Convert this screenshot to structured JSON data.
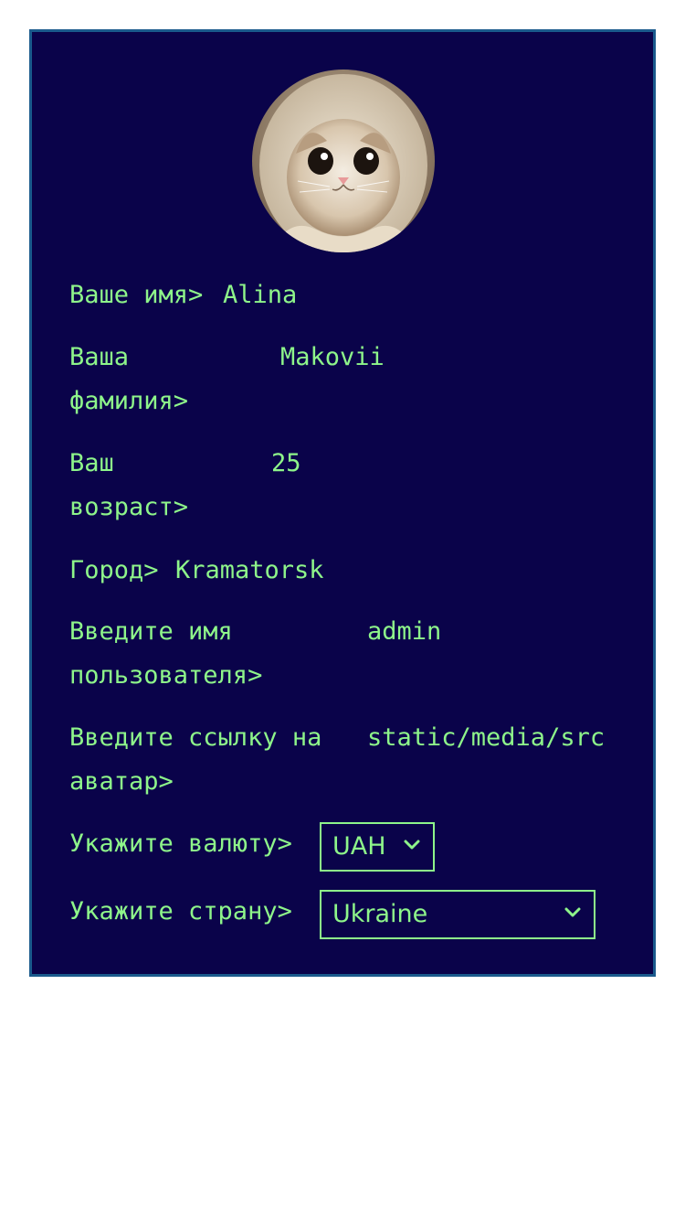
{
  "profile": {
    "avatar_alt": "cat-avatar",
    "fields": [
      {
        "id": "first_name",
        "label": "Ваше имя>",
        "value": "Alina"
      },
      {
        "id": "last_name",
        "label": "Ваша фамилия>",
        "value": "Makovii"
      },
      {
        "id": "age",
        "label": "Ваш возраст>",
        "value": "25"
      },
      {
        "id": "city",
        "label": "Город>",
        "value": "Kramatorsk"
      },
      {
        "id": "username",
        "label": "Введите имя пользователя>",
        "value": "admin"
      },
      {
        "id": "avatar_url",
        "label": "Введите ссылку на аватар>",
        "value": "static/media/src"
      }
    ],
    "currency": {
      "label": "Укажите валюту>",
      "selected": "UAH"
    },
    "country": {
      "label": "Укажите страну>",
      "selected": "Ukraine"
    }
  },
  "colors": {
    "panel_bg": "#0a034a",
    "panel_border": "#1a5a8c",
    "text": "#8ef58a",
    "page_bg": "#ffffff"
  },
  "icons": {
    "select_arrow": "chevron-down-icon"
  }
}
